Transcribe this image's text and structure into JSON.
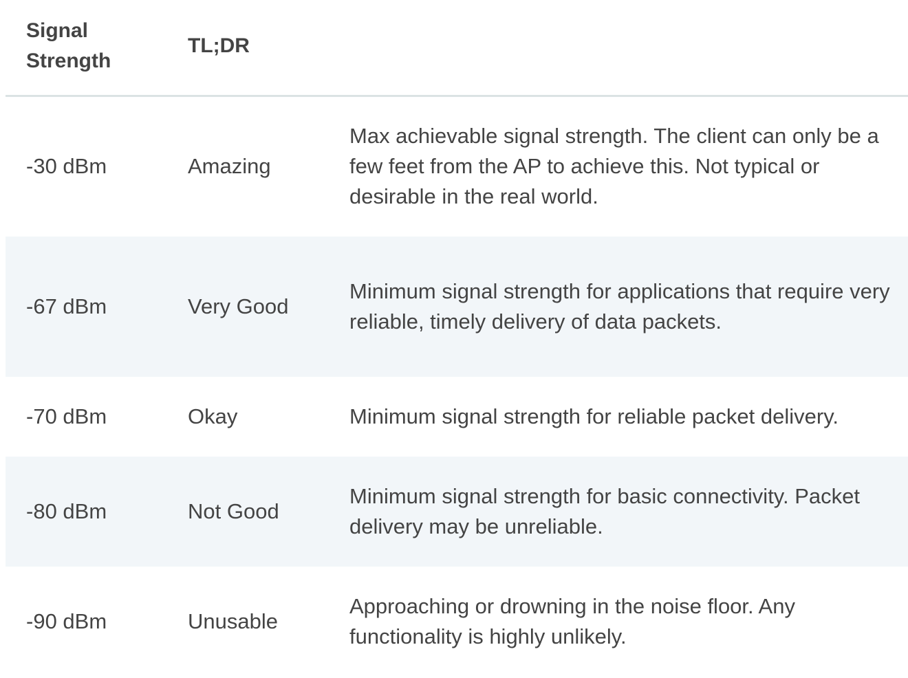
{
  "table": {
    "headers": [
      "Signal\nStrength",
      "TL;DR",
      ""
    ],
    "rows": [
      {
        "strength": "-30 dBm",
        "tldr": "Amazing",
        "description": "Max achievable signal strength. The client can only be a few feet from the AP to achieve this. Not typical or desirable in the real world."
      },
      {
        "strength": "-67 dBm",
        "tldr": "Very Good",
        "description": "Minimum signal strength for applications that require very reliable, timely delivery of data packets."
      },
      {
        "strength": "-70 dBm",
        "tldr": "Okay",
        "description": "Minimum signal strength for reliable packet delivery."
      },
      {
        "strength": "-80 dBm",
        "tldr": "Not Good",
        "description": "Minimum signal strength for basic connectivity. Packet delivery may be unreliable."
      },
      {
        "strength": "-90 dBm",
        "tldr": "Unusable",
        "description": "Approaching or drowning in the noise floor. Any functionality is highly unlikely."
      }
    ]
  },
  "colors": {
    "text": "#444444",
    "stripe": "#f2f6f9",
    "header_rule": "#dbe3e4"
  }
}
